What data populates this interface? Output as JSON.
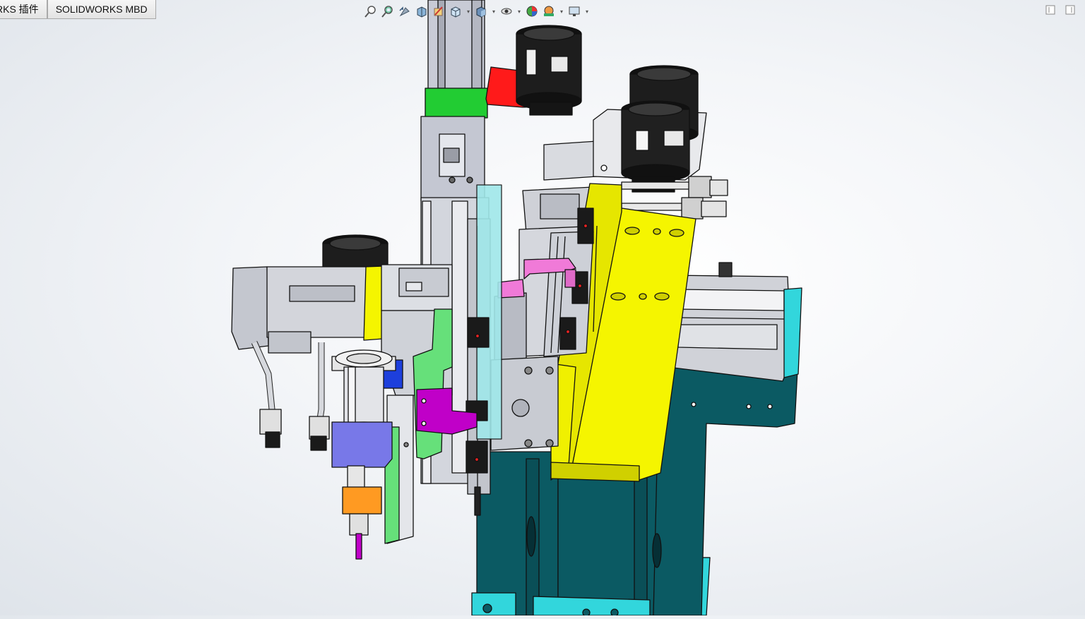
{
  "tabs": [
    {
      "label": "RKS 插件"
    },
    {
      "label": "SOLIDWORKS MBD"
    }
  ],
  "view_toolbar": {
    "icons": [
      "zoom-to-fit-icon",
      "zoom-to-area-icon",
      "previous-view-icon",
      "section-view-icon",
      "dynamic-annotation-icon",
      "view-orientation-icon",
      "display-style-icon",
      "hide-show-items-icon",
      "edit-appearance-icon",
      "apply-scene-icon",
      "view-settings-icon"
    ]
  },
  "window_controls": {
    "icons": [
      "restore-panel-icon",
      "maximize-panel-icon"
    ]
  },
  "model": {
    "colors": {
      "base": "#0b5a63",
      "cyan": "#32d6dc",
      "yellow": "#f5f500",
      "gray": "#c9cbd3",
      "red": "#ff1a1a",
      "green": "#22cc33",
      "magenta": "#c000c8",
      "pink": "#f07ad8",
      "lightgreen": "#66e07a",
      "purple": "#7878e8",
      "orange": "#ff9a22",
      "black": "#1a1a1a"
    }
  }
}
